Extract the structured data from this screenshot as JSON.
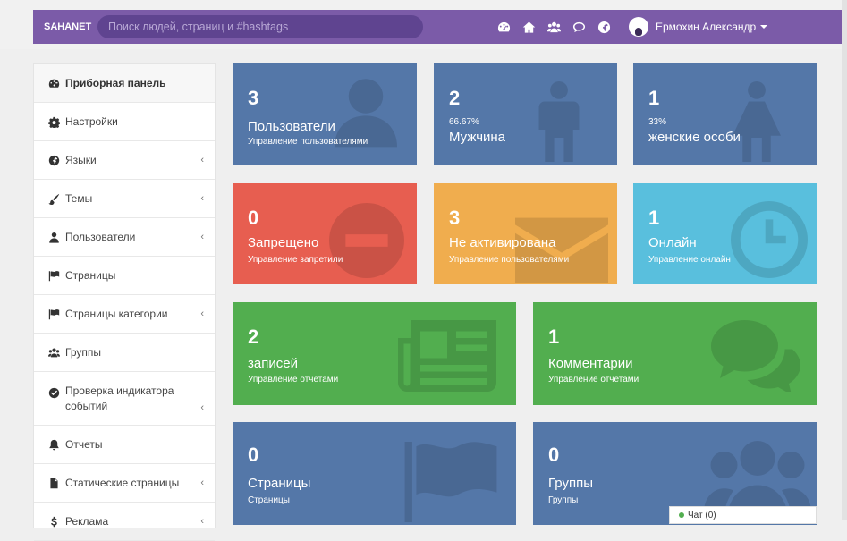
{
  "brand": "SAHANET",
  "search": {
    "placeholder": "Поиск людей, страниц и #hashtags"
  },
  "nav_icons": [
    "dashboard-icon",
    "home-icon",
    "users-icon",
    "chat-icon",
    "globe-icon"
  ],
  "user": {
    "name": "Ермохин Александр"
  },
  "sidebar": {
    "items": [
      {
        "label": "Приборная панель",
        "icon": "dashboard-icon",
        "arrow": ""
      },
      {
        "label": "Настройки",
        "icon": "gear-icon",
        "arrow": ""
      },
      {
        "label": "Языки",
        "icon": "globe-icon",
        "arrow": "‹"
      },
      {
        "label": "Темы",
        "icon": "brush-icon",
        "arrow": "‹"
      },
      {
        "label": "Пользователи",
        "icon": "user-icon",
        "arrow": "‹"
      },
      {
        "label": "Страницы",
        "icon": "flag-icon",
        "arrow": ""
      },
      {
        "label": "Страницы категории",
        "icon": "flag-icon",
        "arrow": "‹"
      },
      {
        "label": "Группы",
        "icon": "users-icon",
        "arrow": ""
      },
      {
        "label": "Проверка индикатора событий",
        "icon": "check-circle-icon",
        "arrow": "‹"
      },
      {
        "label": "Отчеты",
        "icon": "bell-icon",
        "arrow": ""
      },
      {
        "label": "Статические страницы",
        "icon": "file-icon",
        "arrow": "‹"
      },
      {
        "label": "Реклама",
        "icon": "dollar-icon",
        "arrow": "‹"
      }
    ]
  },
  "tiles": {
    "users": {
      "num": "3",
      "title": "Пользователи",
      "sub": "Управление пользователями"
    },
    "male": {
      "num": "2",
      "pct": "66.67%",
      "title": "Мужчина"
    },
    "female": {
      "num": "1",
      "pct": "33%",
      "title": "женские особи"
    },
    "banned": {
      "num": "0",
      "title": "Запрещено",
      "sub": "Управление запретили"
    },
    "inactive": {
      "num": "3",
      "title": "Не активирована",
      "sub": "Управление пользователями"
    },
    "online": {
      "num": "1",
      "title": "Онлайн",
      "sub": "Управление онлайн"
    },
    "posts": {
      "num": "2",
      "title": "записей",
      "sub": "Управление отчетами"
    },
    "comments": {
      "num": "1",
      "title": "Комментарии",
      "sub": "Управление отчетами"
    },
    "pages": {
      "num": "0",
      "title": "Страницы",
      "sub": "Страницы"
    },
    "groups": {
      "num": "0",
      "title": "Группы",
      "sub": "Группы"
    }
  },
  "chat": {
    "label": "Чат (0)"
  },
  "colors": {
    "navbar": "#7b5ba8",
    "blue": "#5477a8",
    "red": "#e75e50",
    "orange": "#f0ad4e",
    "cyan": "#59bfdd",
    "green": "#52ae4f"
  }
}
